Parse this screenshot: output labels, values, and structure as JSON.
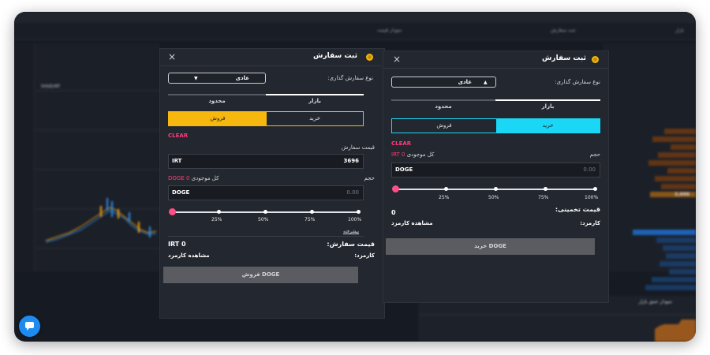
{
  "colors": {
    "sell_accent": "#f6b70f",
    "buy_accent": "#1ad8f5",
    "clear": "#ff3b7a",
    "slider": "#ff4f86",
    "dialog_bg": "#23272f",
    "chat_button": "#1d8bf0"
  },
  "sell_dialog": {
    "title": "ثبت سفارش",
    "order_type_label": "نوع سفارش گذاری:",
    "order_type_value": "عادی",
    "tab_market": "بازار",
    "tab_limit": "محدود",
    "active_tab": "limit",
    "buy_label": "خرید",
    "sell_label": "فروش",
    "active_side": "sell",
    "clear_label": "CLEAR",
    "price_label": "قیمت سفارش",
    "price_unit": "IRT",
    "price_value": "3696",
    "volume_label": "حجم",
    "balance_label": "کل موجودی",
    "balance_value": "DOGE 0",
    "volume_unit": "DOGE",
    "volume_placeholder": "0.00",
    "slider_percent": 0,
    "slider_ticks": [
      "25%",
      "50%",
      "75%",
      "100%"
    ],
    "advanced_label": "پیشرفته",
    "order_price_label": "قیمت سفارش:",
    "order_price_value": "IRT 0",
    "fee_label": "کارمزد:",
    "fee_value": "مشاهده کارمزد",
    "submit_label": "فروش DOGE"
  },
  "buy_dialog": {
    "title": "ثبت سفارش",
    "order_type_label": "نوع سفارش گذاری:",
    "order_type_value": "عادی",
    "tab_market": "بازار",
    "tab_limit": "محدود",
    "active_tab": "market",
    "buy_label": "خرید",
    "sell_label": "فروش",
    "active_side": "buy",
    "clear_label": "CLEAR",
    "volume_label": "حجم",
    "balance_label": "کل موجودی",
    "balance_value": "IRT 0",
    "volume_unit": "DOGE",
    "volume_placeholder": "0.00",
    "slider_percent": 0,
    "slider_ticks": [
      "25%",
      "50%",
      "75%",
      "100%"
    ],
    "estimated_price_label": "قیمت تخمینی:",
    "estimated_price_value": "0",
    "fee_label": "کارمزد:",
    "fee_value": "مشاهده کارمزد",
    "submit_label": "خرید DOGE"
  },
  "background": {
    "tab_price_chart": "نمودار قیمت",
    "tab_order": "ثبت سفارش",
    "tab_market": "بازار",
    "chart_symbol": "DOGE/IRT",
    "last_price": "3,696",
    "depth_chart": "نمودار عمق بازار"
  }
}
